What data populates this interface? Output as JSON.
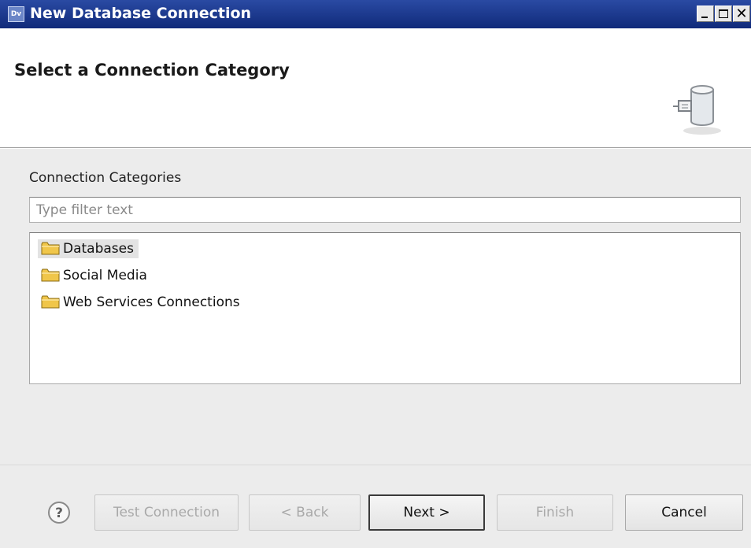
{
  "window": {
    "title": "New Database Connection",
    "app_icon_label": "Dv",
    "close_symbol": "✕"
  },
  "header": {
    "title": "Select a Connection Category",
    "icon": "database-connection-icon"
  },
  "categories": {
    "label": "Connection Categories",
    "filter_placeholder": "Type filter text",
    "filter_value": "",
    "items": [
      {
        "label": "Databases",
        "icon": "folder-icon",
        "selected": true
      },
      {
        "label": "Social Media",
        "icon": "folder-icon",
        "selected": false
      },
      {
        "label": "Web Services Connections",
        "icon": "folder-icon",
        "selected": false
      }
    ]
  },
  "buttons": {
    "help_icon": "help-icon",
    "test_connection": "Test Connection",
    "back": "< Back",
    "next": "Next >",
    "finish": "Finish",
    "cancel": "Cancel"
  },
  "colors": {
    "titlebar": "#1b3a8f",
    "folder": "#f0c64a",
    "dialog_background": "#ececec"
  }
}
